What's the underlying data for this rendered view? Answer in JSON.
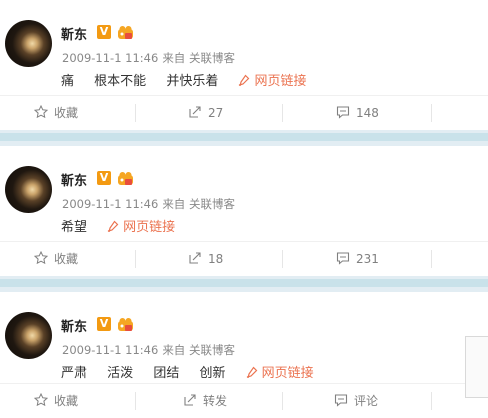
{
  "posts": [
    {
      "author": "靳东",
      "verified_badge": "V",
      "meta_time": "2009-11-1 11:46",
      "meta_source": "来自 关联博客",
      "content_words": [
        "痛",
        "根本不能",
        "并快乐着"
      ],
      "link_label": "网页链接",
      "actions": {
        "favorite": "收藏",
        "repost": "27",
        "comment": "148"
      }
    },
    {
      "author": "靳东",
      "verified_badge": "V",
      "meta_time": "2009-11-1 11:46",
      "meta_source": "来自 关联博客",
      "content_words": [
        "希望"
      ],
      "link_label": "网页链接",
      "actions": {
        "favorite": "收藏",
        "repost": "18",
        "comment": "231"
      }
    },
    {
      "author": "靳东",
      "verified_badge": "V",
      "meta_time": "2009-11-1 11:46",
      "meta_source": "来自 关联博客",
      "content_words": [
        "严肃",
        "活泼",
        "团结",
        "创新"
      ],
      "link_label": "网页链接",
      "actions": {
        "favorite": "收藏",
        "repost": "转发",
        "comment": "评论"
      }
    }
  ],
  "icons": {
    "verified": "verified-v-badge",
    "member": "crown-member-icon",
    "link": "link-pin-icon",
    "favorite": "star-icon",
    "repost": "repost-arrow-icon",
    "comment": "comment-bubble-icon"
  },
  "colors": {
    "link": "#eb7350",
    "badge": "#f39a12",
    "separator": "#c9e2ea",
    "meta_text": "#888888"
  }
}
